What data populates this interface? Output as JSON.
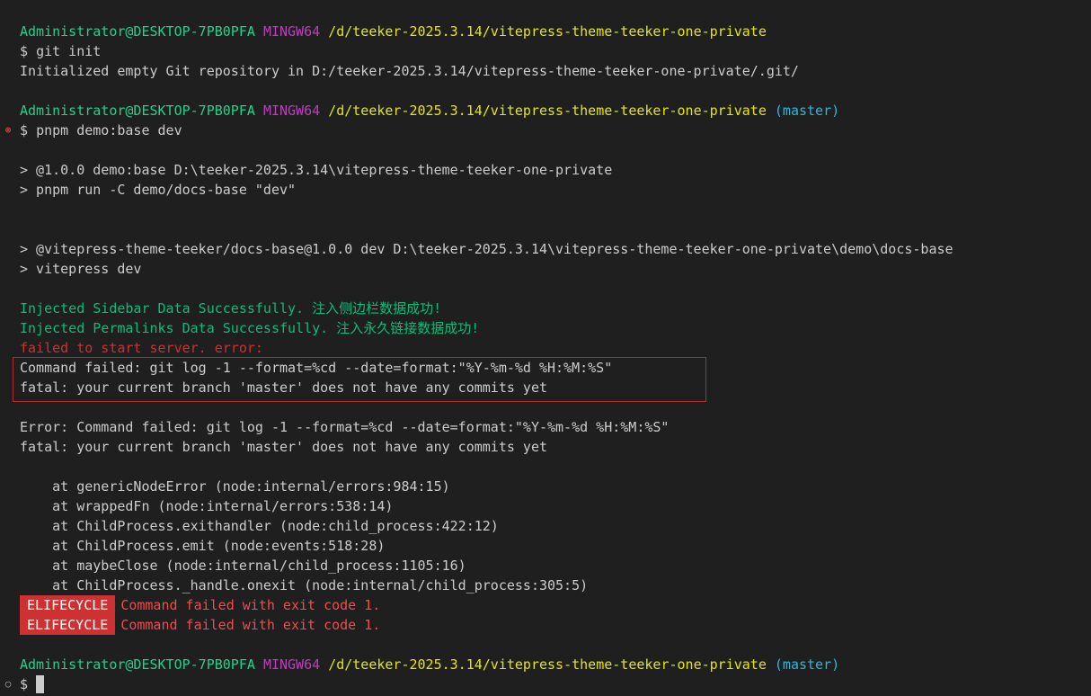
{
  "prompt": {
    "user": "Administrator@DESKTOP-7PB0PFA",
    "shell": "MINGW64",
    "path": "/d/teeker-2025.3.14/vitepress-theme-teeker-one-private",
    "branch": "(master)",
    "symbol": "$"
  },
  "lines": {
    "cmd_git_init": "git init",
    "init_output": "Initialized empty Git repository in D:/teeker-2025.3.14/vitepress-theme-teeker-one-private/.git/",
    "cmd_pnpm": "pnpm demo:base dev",
    "pnpm_out_1": "> @1.0.0 demo:base D:\\teeker-2025.3.14\\vitepress-theme-teeker-one-private",
    "pnpm_out_2": "> pnpm run -C demo/docs-base \"dev\"",
    "pnpm_out_3": "> @vitepress-theme-teeker/docs-base@1.0.0 dev D:\\teeker-2025.3.14\\vitepress-theme-teeker-one-private\\demo\\docs-base",
    "pnpm_out_4": "> vitepress dev",
    "inject_sidebar": "Injected Sidebar Data Successfully. 注入侧边栏数据成功!",
    "inject_permalinks": "Injected Permalinks Data Successfully. 注入永久链接数据成功!",
    "failed_start": "failed to start server. error:",
    "cmd_failed": "Command failed: git log -1 --format=%cd --date=format:\"%Y-%m-%d %H:%M:%S\"",
    "fatal_1": "fatal: your current branch 'master' does not have any commits yet",
    "error_cmd_failed": "Error: Command failed: git log -1 --format=%cd --date=format:\"%Y-%m-%d %H:%M:%S\"",
    "fatal_2": "fatal: your current branch 'master' does not have any commits yet",
    "stack": [
      "    at genericNodeError (node:internal/errors:984:15)",
      "    at wrappedFn (node:internal/errors:538:14)",
      "    at ChildProcess.exithandler (node:child_process:422:12)",
      "    at ChildProcess.emit (node:events:518:28)",
      "    at maybeClose (node:internal/child_process:1105:16)",
      "    at ChildProcess._handle.onexit (node:internal/child_process:305:5)"
    ],
    "lifecycle_badge": "ELIFECYCLE",
    "lifecycle_msg": "Command failed with exit code 1."
  },
  "markers": {
    "error_icon": "x-circle-icon",
    "idle_icon": "circle-icon"
  },
  "colors": {
    "background": "#1f1f1f",
    "user": "#23d18b",
    "shell": "#bc3fbc",
    "path": "#e5e510",
    "branch": "#29b8db",
    "error": "#f14c4c",
    "badge_bg": "#cd3131",
    "highlight_border": "#b52a2a"
  }
}
